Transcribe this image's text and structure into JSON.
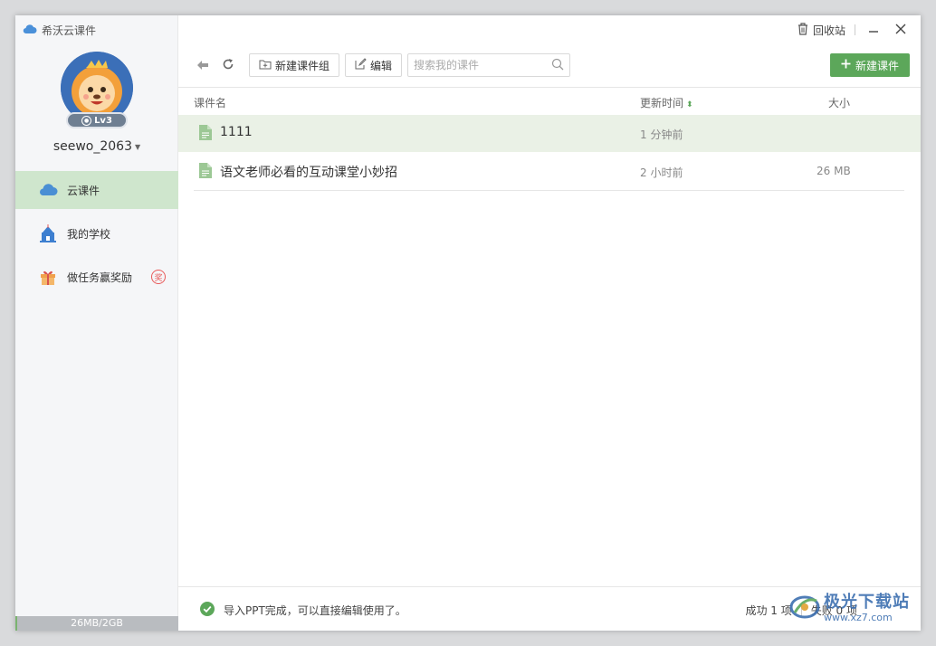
{
  "app": {
    "title": "希沃云课件"
  },
  "user": {
    "name": "seewo_2063",
    "level": "Lv3"
  },
  "nav": {
    "items": [
      {
        "label": "云课件",
        "icon": "cloud-icon",
        "active": true
      },
      {
        "label": "我的学校",
        "icon": "school-icon",
        "active": false
      },
      {
        "label": "做任务赢奖励",
        "icon": "gift-icon",
        "active": false,
        "badge": "奖"
      }
    ]
  },
  "storage": {
    "text": "26MB/2GB",
    "used_fraction": 0.013
  },
  "window": {
    "recycle_label": "回收站"
  },
  "toolbar": {
    "new_group_label": "新建课件组",
    "edit_label": "编辑",
    "search_placeholder": "搜索我的课件",
    "new_courseware_label": "新建课件"
  },
  "table": {
    "headers": {
      "name": "课件名",
      "time": "更新时间",
      "size": "大小"
    },
    "rows": [
      {
        "name": "1111",
        "time": "1 分钟前",
        "size": ""
      },
      {
        "name": "语文老师必看的互动课堂小妙招",
        "time": "2 小时前",
        "size": "26 MB"
      }
    ]
  },
  "status": {
    "message": "导入PPT完成，可以直接编辑使用了。",
    "success": "成功 1 项",
    "failed": "失败 0 项"
  },
  "watermark": {
    "site_name": "极光下载站",
    "url": "www.xz7.com"
  },
  "colors": {
    "accent": "#5ca75a",
    "active_nav": "#cfe6cd",
    "selected_row": "#eaf1e6"
  }
}
